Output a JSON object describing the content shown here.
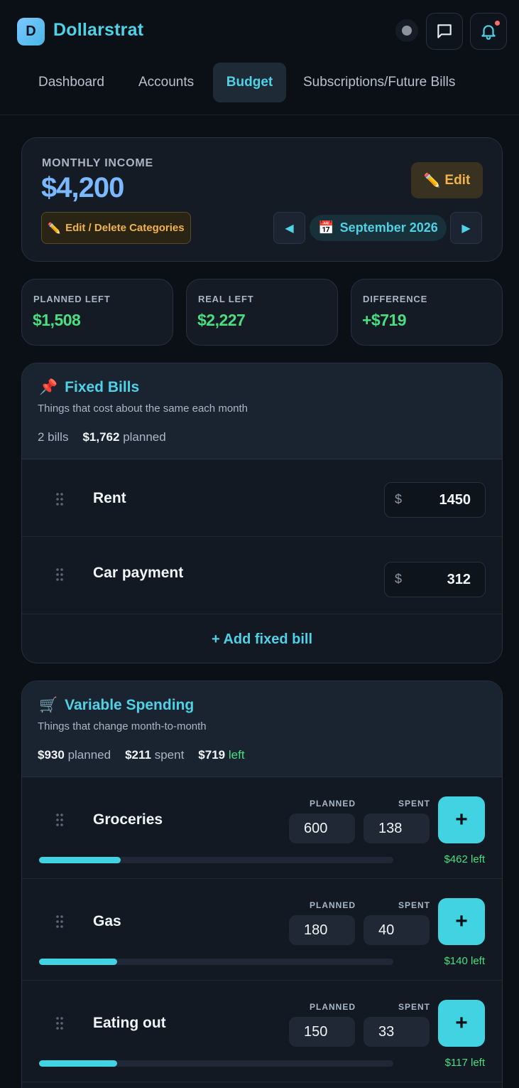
{
  "brand": {
    "initial": "D",
    "name": "Dollarstrat"
  },
  "header": {
    "icons": [
      "status-dot",
      "chat-icon",
      "bell-icon"
    ],
    "notification_color": "#ff6b6b"
  },
  "tabs": [
    {
      "label": "Dashboard",
      "active": false
    },
    {
      "label": "Accounts",
      "active": false
    },
    {
      "label": "Budget",
      "active": true
    },
    {
      "label": "Subscriptions/Future Bills",
      "active": false
    },
    {
      "label": "",
      "active": false
    }
  ],
  "income": {
    "label": "MONTHLY INCOME",
    "value": "$4,200",
    "edit_label": "Edit",
    "edit_categories_label": "Edit / Delete Categories",
    "month": "September 2026"
  },
  "stats": [
    {
      "label": "PLANNED LEFT",
      "value": "$1,508"
    },
    {
      "label": "REAL LEFT",
      "value": "$2,227"
    },
    {
      "label": "DIFFERENCE",
      "value": "+$719"
    }
  ],
  "fixed": {
    "icon": "📌",
    "title": "Fixed Bills",
    "subtitle": "Things that cost about the same each month",
    "count": "2 bills",
    "planned_total": "$1,762",
    "planned_word": "planned",
    "bills": [
      {
        "name": "Rent",
        "currency": "$",
        "amount": "1450"
      },
      {
        "name": "Car payment",
        "currency": "$",
        "amount": "312"
      }
    ],
    "add_label": "+ Add fixed bill"
  },
  "variable": {
    "icon": "🛒",
    "title": "Variable Spending",
    "subtitle": "Things that change month-to-month",
    "planned_total": "$930",
    "planned_word": "planned",
    "spent_total": "$211",
    "spent_word": "spent",
    "left_total": "$719",
    "left_word": "left",
    "col_planned": "PLANNED",
    "col_spent": "SPENT",
    "items": [
      {
        "name": "Groceries",
        "planned": "600",
        "spent": "138",
        "left": "$462 left",
        "progress": 0.23
      },
      {
        "name": "Gas",
        "planned": "180",
        "spent": "40",
        "left": "$140 left",
        "progress": 0.22
      },
      {
        "name": "Eating out",
        "planned": "150",
        "spent": "33",
        "left": "$117 left",
        "progress": 0.22
      }
    ],
    "plus_label": "+"
  },
  "colors": {
    "accent": "#4fd1e6",
    "income": "#7ab8ff",
    "positive": "#4ade80",
    "warn": "#f2b34b"
  }
}
